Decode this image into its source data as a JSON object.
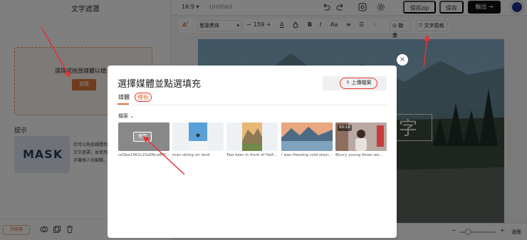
{
  "left_panel": {
    "title": "文字遮罩",
    "dropzone_text": "選擇或拖放媒體以填充",
    "dropzone_button": "瀏覽",
    "hint_title": "提示",
    "hint_example": "MASK",
    "hint_desc": "您可以拖放媒體到文字遮罩，並使用手機個人化編輯。",
    "promo_badge": "許閱讀"
  },
  "topbar": {
    "ratio": "16:9",
    "ratio_caret": "▾",
    "doc_title": "Untitled",
    "save_zip": "保存zip",
    "save": "保存",
    "export": "輸出",
    "export_arrow": "→"
  },
  "formatbar": {
    "font_name": "思源黑体",
    "font_size": "159",
    "minus": "−",
    "plus": "+",
    "bold": "B",
    "animate": "動畫",
    "text_style": "文字風格"
  },
  "zoom": {
    "label": "適應"
  },
  "modal": {
    "title": "選擇媒體並點選填充",
    "upload_label": "上傳檔案",
    "tabs": [
      "媒體",
      "模板"
    ],
    "filter_label": "檔案",
    "close": "×",
    "items": [
      {
        "caption": "cd3ee1961c22a06ca84f0...",
        "use_label": "使用",
        "has_use": true,
        "duration": ""
      },
      {
        "caption": "man skiing on land",
        "has_use": false,
        "duration": ""
      },
      {
        "caption": "Two deer in front of Half...",
        "has_use": false,
        "duration": ""
      },
      {
        "caption": "I was freezing cold stayin...",
        "has_use": false,
        "duration": ""
      },
      {
        "caption": "Blurry young Asian woma...",
        "has_use": false,
        "duration": "00:18"
      }
    ]
  },
  "canvas": {
    "glyph": "字"
  },
  "colors": {
    "accent": "#e2783a",
    "annotation_red": "#e33333",
    "export_bg": "#111111"
  }
}
